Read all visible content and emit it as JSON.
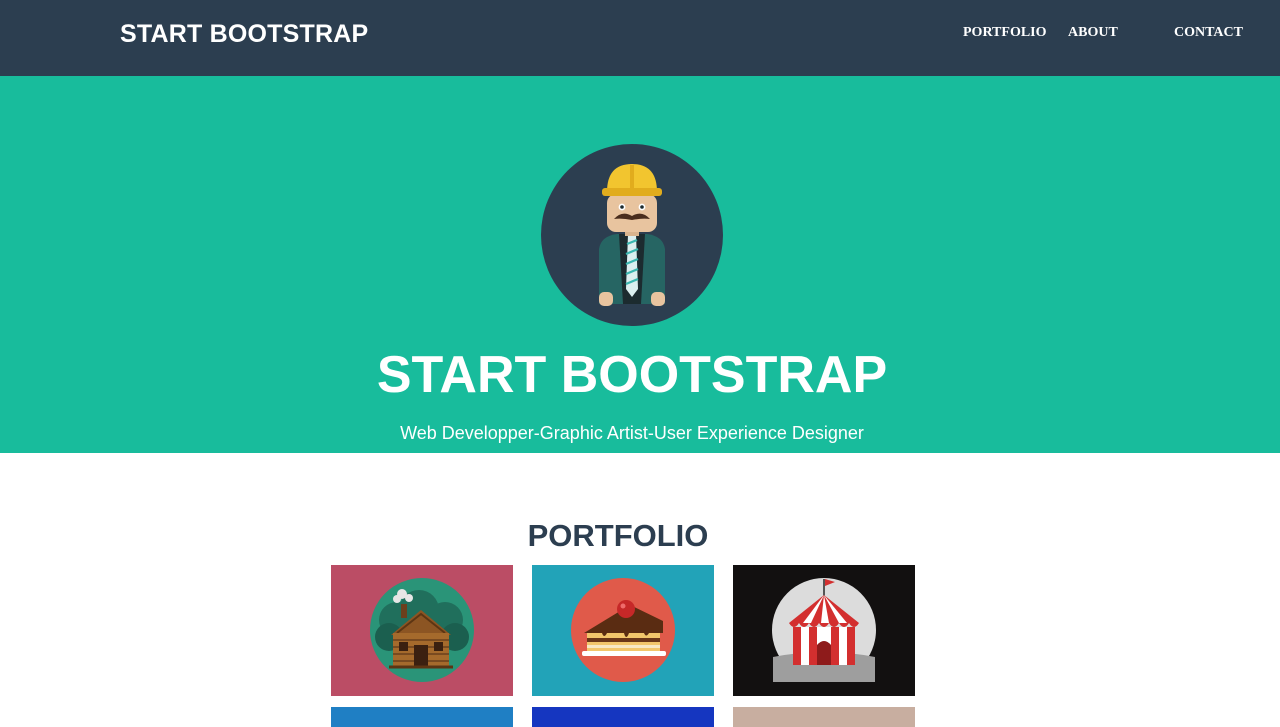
{
  "navbar": {
    "brand": "START BOOTSTRAP",
    "links": [
      "PORTFOLIO",
      "ABOUT",
      "CONTACT"
    ]
  },
  "hero": {
    "title": "START BOOTSTRAP",
    "subtitle": "Web Developper-Graphic Artist-User Experience Designer",
    "avatar_icon": "construction-worker-icon"
  },
  "portfolio": {
    "title": "PORTFOLIO",
    "items": [
      {
        "icon": "log-cabin-icon",
        "background": "#bb4d65"
      },
      {
        "icon": "cake-slice-icon",
        "background": "#22a3b8"
      },
      {
        "icon": "circus-tent-icon",
        "background": "#121010"
      },
      {
        "icon": "image-icon",
        "background": "#1f7fc4"
      },
      {
        "icon": "image-icon",
        "background": "#1536c0"
      },
      {
        "icon": "image-icon",
        "background": "#c8aea0"
      }
    ]
  },
  "colors": {
    "navbar": "#2c3e50",
    "hero": "#18bc9c",
    "heading": "#2c3e50"
  }
}
